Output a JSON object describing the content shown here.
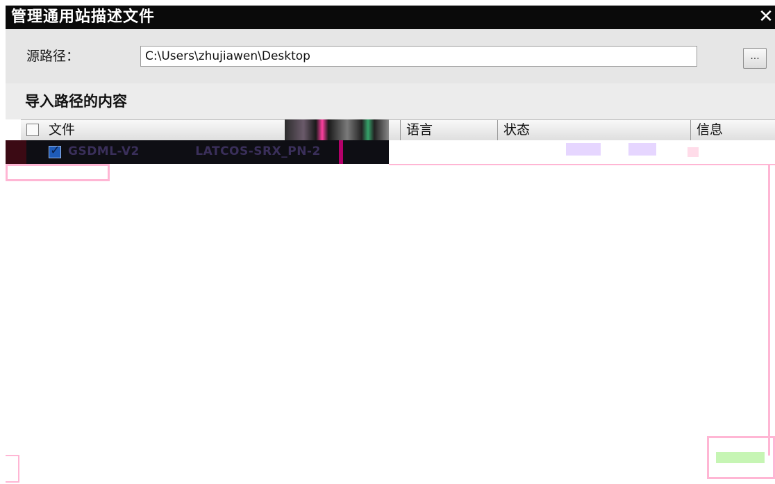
{
  "dialog": {
    "title": "管理通用站描述文件",
    "close_icon": "close-icon",
    "close_glyph": "✕"
  },
  "source": {
    "label": "源路径：",
    "path_value": "C:\\Users\\zhujiawen\\Desktop",
    "browse_label": "..."
  },
  "content_section": {
    "title": "导入路径的内容"
  },
  "table": {
    "columns": {
      "file": "文件",
      "language": "语言",
      "status": "状态",
      "info": "信息"
    },
    "rows": [
      {
        "checked": true,
        "file": "GSDML-V2",
        "file_tail": "LATCOS-SRX_PN-2"
      }
    ]
  },
  "colors": {
    "titlebar": "#0a0a0a",
    "panel_bg": "#e6e6e6",
    "checkbox_checked": "#1e5bb8",
    "artifact_pink": "#ffb6d4"
  }
}
